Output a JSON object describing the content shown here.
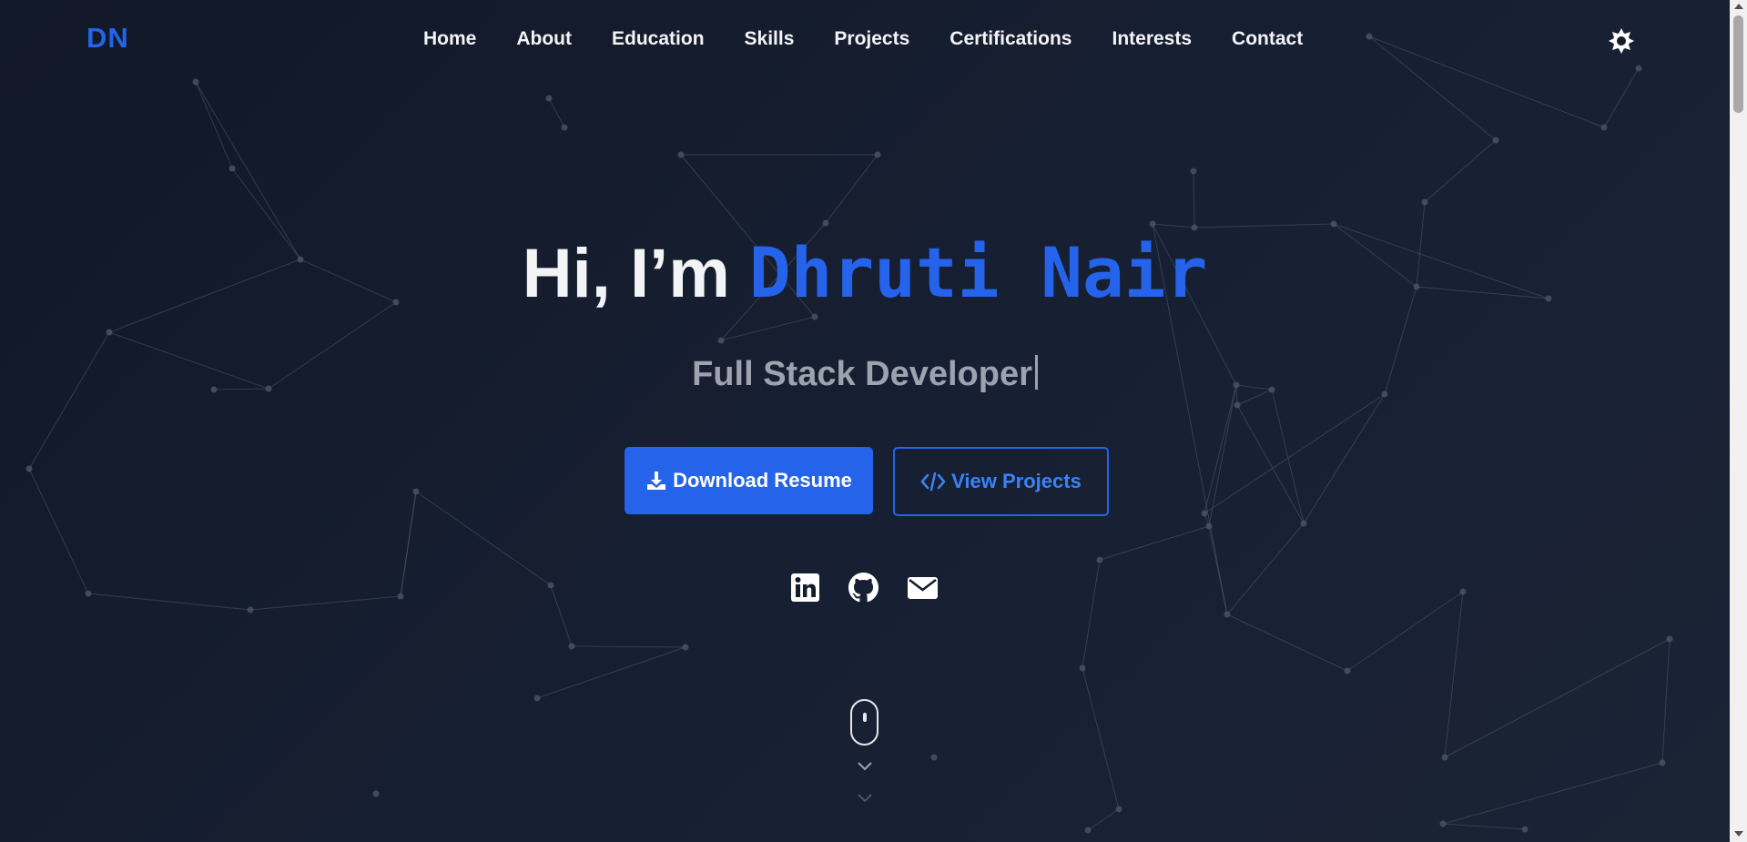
{
  "nav": {
    "logo": "DN",
    "items": [
      {
        "label": "Home"
      },
      {
        "label": "About"
      },
      {
        "label": "Education"
      },
      {
        "label": "Skills"
      },
      {
        "label": "Projects"
      },
      {
        "label": "Certifications"
      },
      {
        "label": "Interests"
      },
      {
        "label": "Contact"
      }
    ],
    "theme_toggle_icon": "sun-icon"
  },
  "hero": {
    "greeting": "Hi, I’m",
    "name": "Dhruti Nair",
    "subtitle": "Full Stack Developer",
    "buttons": {
      "download": {
        "label": "Download Resume",
        "icon": "download-icon"
      },
      "projects": {
        "label": "View Projects",
        "icon": "code-icon"
      }
    },
    "socials": [
      {
        "name": "linkedin-icon"
      },
      {
        "name": "github-icon"
      },
      {
        "name": "envelope-icon"
      }
    ],
    "scroll_indicator": "mouse-icon"
  },
  "colors": {
    "accent": "#2563eb",
    "background": "#151c2c",
    "text": "#f3f4f6",
    "muted": "#9ca3af"
  }
}
